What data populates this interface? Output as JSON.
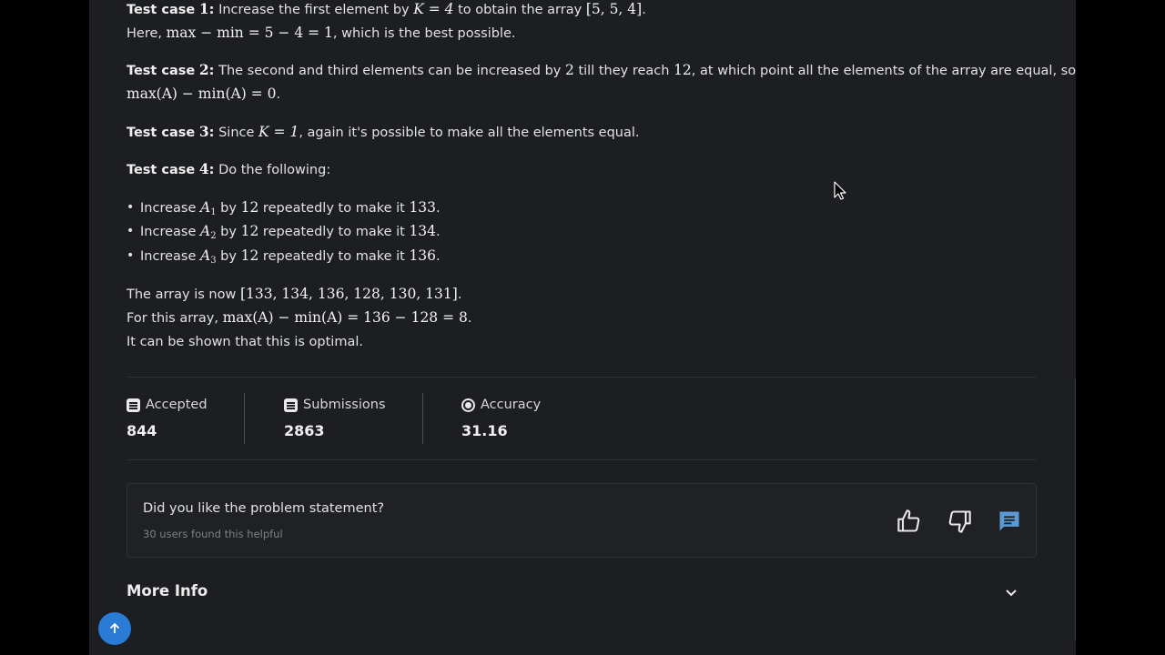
{
  "explanation": {
    "tc1": {
      "label": "Test case",
      "num": "1",
      "colon": ":",
      "t1": " Increase the first element by ",
      "m1": "K = 4",
      "t2": " to obtain the array ",
      "m2": "[5, 5, 4]",
      "t3": "."
    },
    "tc1_line2": {
      "t1": "Here, ",
      "m1": "max − min = 5 − 4 = 1",
      "t2": ", which is the best possible."
    },
    "tc2": {
      "label": "Test case",
      "num": "2",
      "colon": ":",
      "t1": " The second and third elements can be increased by ",
      "m1": "2",
      "t2": " till they reach ",
      "m2": "12",
      "t3": ", at which point all the elements of the array are equal, so"
    },
    "tc2_line2": {
      "m1": "max(A) − min(A) = 0",
      "t1": "."
    },
    "tc3": {
      "label": "Test case",
      "num": "3",
      "colon": ":",
      "t1": " Since ",
      "m1": "K = 1",
      "t2": ", again it's possible to make all the elements equal."
    },
    "tc4": {
      "label": "Test case",
      "num": "4",
      "colon": ":",
      "t1": " Do the following:"
    },
    "bullets": [
      {
        "t1": "Increase ",
        "var": "A",
        "sub": "1",
        "t2": " by ",
        "m1": "12",
        "t3": " repeatedly to make it ",
        "m2": "133",
        "t4": "."
      },
      {
        "t1": "Increase ",
        "var": "A",
        "sub": "2",
        "t2": " by ",
        "m1": "12",
        "t3": " repeatedly to make it ",
        "m2": "134",
        "t4": "."
      },
      {
        "t1": "Increase ",
        "var": "A",
        "sub": "3",
        "t2": " by ",
        "m1": "12",
        "t3": " repeatedly to make it ",
        "m2": "136",
        "t4": "."
      }
    ],
    "result1": {
      "t1": "The array is now ",
      "m1": "[133, 134, 136, 128, 130, 131]",
      "t2": "."
    },
    "result2": {
      "t1": "For this array, ",
      "m1": "max(A) − min(A) = 136 − 128 = 8",
      "t2": "."
    },
    "result3": {
      "t1": "It can be shown that this is optimal."
    }
  },
  "stats": [
    {
      "label": "Accepted",
      "value": "844",
      "icon": "accepted-icon"
    },
    {
      "label": "Submissions",
      "value": "2863",
      "icon": "submissions-icon"
    },
    {
      "label": "Accuracy",
      "value": "31.16",
      "icon": "accuracy-icon"
    }
  ],
  "feedback": {
    "question": "Did you like the problem statement?",
    "helpful_text": "30 users found this helpful",
    "icons": [
      "thumbs-up-icon",
      "thumbs-down-icon",
      "comment-icon"
    ]
  },
  "more_info": {
    "label": "More Info"
  },
  "colors": {
    "background": "#1c1e21",
    "page_outer": "#000000",
    "accent_blue": "#2a7bd6",
    "comment_icon": "#5b9bd5"
  }
}
